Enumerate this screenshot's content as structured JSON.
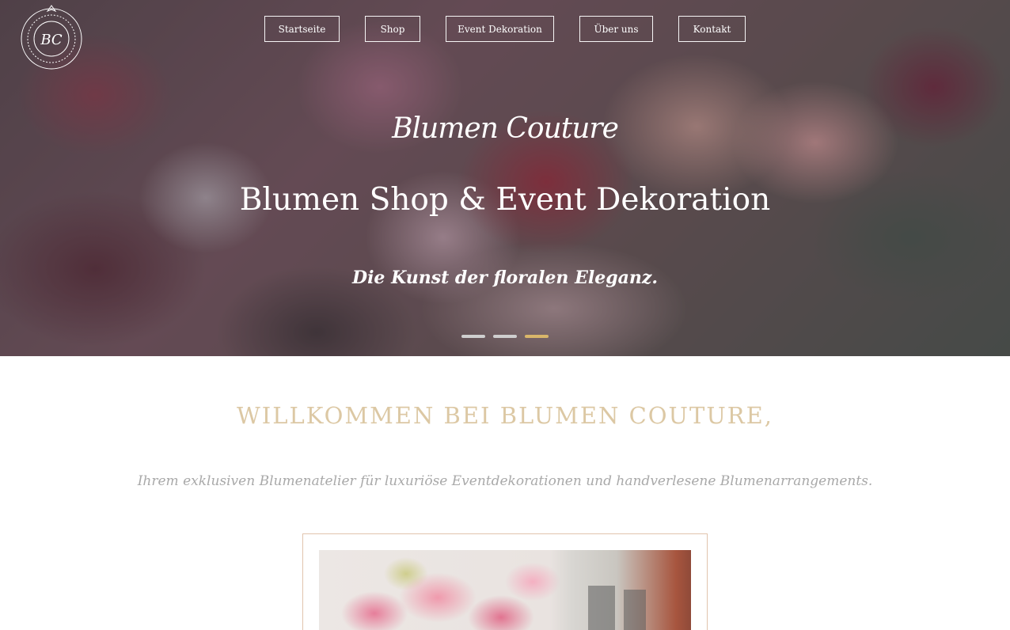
{
  "logo": {
    "monogram": "BC",
    "ring_text": "Designs für unvergessliche Anlässe"
  },
  "nav": {
    "items": [
      {
        "label": "Startseite"
      },
      {
        "label": "Shop"
      },
      {
        "label": "Event Dekoration"
      },
      {
        "label": "Über uns"
      },
      {
        "label": "Kontakt"
      }
    ]
  },
  "hero": {
    "brand": "Blumen Couture",
    "title": "Blumen Shop & Event Dekoration",
    "tagline": "Die Kunst der floralen Eleganz.",
    "slider": {
      "slide_count": 3,
      "active_slide": 3
    }
  },
  "welcome": {
    "title": "WILLKOMMEN BEI BLUMEN COUTURE,",
    "subtitle": "Ihrem exklusiven Blumenatelier für luxuriöse Eventdekorationen und handverlesene Blumenarrangements."
  },
  "colors": {
    "accent_gold": "#d9b66a",
    "welcome_title": "#dcc8a4",
    "subtitle_gray": "#a9a9a9",
    "frame_border": "#e2c4ad"
  }
}
